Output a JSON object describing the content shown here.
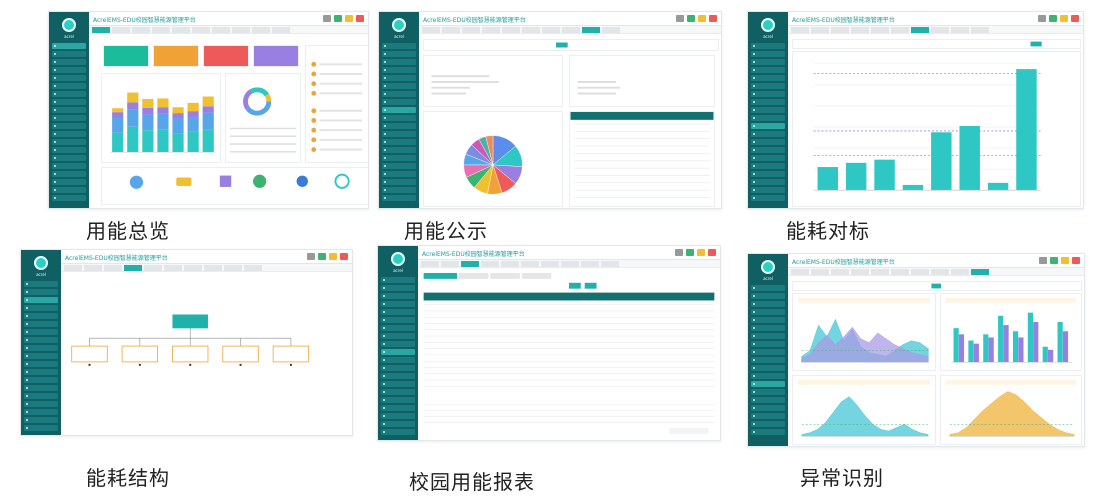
{
  "app_title": "AcrelEMS-EDU校园智慧能源管理平台",
  "captions": {
    "overview": "用能总览",
    "publicity": "用能公示",
    "benchmark": "能耗对标",
    "structure": "能耗结构",
    "report": "校园用能报表",
    "anomaly": "异常识别"
  },
  "colors": {
    "sidebar": "#0f5f63",
    "teal": "#2fc7c3",
    "accent": "#20b2aa",
    "green": "#1ab394",
    "orange": "#f0a236",
    "red": "#ee5a5a",
    "purple": "#9a7fe3",
    "blue": "#58a6ea"
  },
  "benchmark_chart": {
    "type": "bar",
    "values": [
      2.2,
      2.6,
      2.9,
      0.5,
      5.5,
      6.1,
      0.7,
      11.5
    ],
    "ylim": [
      0,
      12
    ]
  },
  "overview_stack_chart": {
    "type": "bar",
    "series": [
      {
        "values": [
          40,
          52,
          45,
          46,
          38,
          42,
          47
        ]
      },
      {
        "values": [
          30,
          35,
          32,
          33,
          31,
          30,
          34
        ]
      },
      {
        "values": [
          12,
          15,
          14,
          13,
          11,
          12,
          13
        ]
      },
      {
        "values": [
          8,
          20,
          18,
          18,
          12,
          17,
          20
        ]
      }
    ]
  },
  "publicity_pie": {
    "type": "pie",
    "values": [
      14,
      12,
      10,
      9,
      8,
      8,
      7,
      7,
      6,
      6,
      5,
      4,
      4
    ]
  },
  "anomaly_charts": {
    "area_a": [
      6,
      12,
      38,
      26,
      44,
      22,
      34,
      16,
      10,
      8,
      6,
      12,
      18,
      22,
      20,
      14
    ],
    "area_b": [
      4,
      8,
      20,
      28,
      18,
      26,
      36,
      24,
      20,
      30,
      24,
      18,
      14,
      10,
      8,
      6
    ],
    "bars": [
      22,
      14,
      18,
      30,
      20,
      32,
      10,
      26
    ],
    "bars2": [
      18,
      12,
      16,
      24,
      16,
      26,
      8,
      20
    ],
    "peak_a": [
      2,
      4,
      8,
      16,
      28,
      40,
      46,
      36,
      24,
      14,
      8,
      6,
      10,
      14,
      8,
      4,
      2
    ],
    "peak_b": [
      2,
      4,
      10,
      20,
      30,
      38,
      46,
      52,
      48,
      40,
      30,
      22,
      14,
      8,
      4,
      2
    ]
  }
}
